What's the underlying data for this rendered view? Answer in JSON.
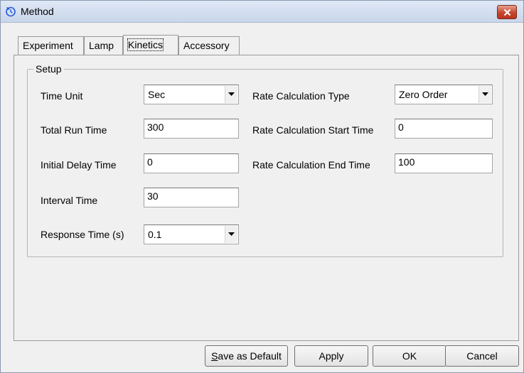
{
  "window": {
    "title": "Method",
    "icon": "refresh-clock-icon",
    "close_icon": "close-icon"
  },
  "tabs": [
    {
      "label": "Experiment",
      "active": false
    },
    {
      "label": "Lamp",
      "active": false
    },
    {
      "label": "Kinetics",
      "active": true
    },
    {
      "label": "Accessory",
      "active": false
    }
  ],
  "setup": {
    "group_title": "Setup",
    "time_unit": {
      "label": "Time Unit",
      "value": "Sec"
    },
    "total_run_time": {
      "label": "Total Run Time",
      "value": "300"
    },
    "initial_delay_time": {
      "label": "Initial Delay Time",
      "value": "0"
    },
    "interval_time": {
      "label": "Interval Time",
      "value": "30"
    },
    "response_time": {
      "label": "Response Time (s)",
      "value": "0.1"
    },
    "rate_calc_type": {
      "label": "Rate Calculation Type",
      "value": "Zero Order"
    },
    "rate_calc_start": {
      "label": "Rate Calculation Start Time",
      "value": "0"
    },
    "rate_calc_end": {
      "label": "Rate Calculation End Time",
      "value": "100"
    }
  },
  "buttons": {
    "save_default_mnemonic": "S",
    "save_default_rest": "ave as Default",
    "apply": "Apply",
    "ok": "OK",
    "cancel": "Cancel"
  },
  "colors": {
    "close_button": "#c7452d",
    "window_bg": "#f0f0f0"
  }
}
